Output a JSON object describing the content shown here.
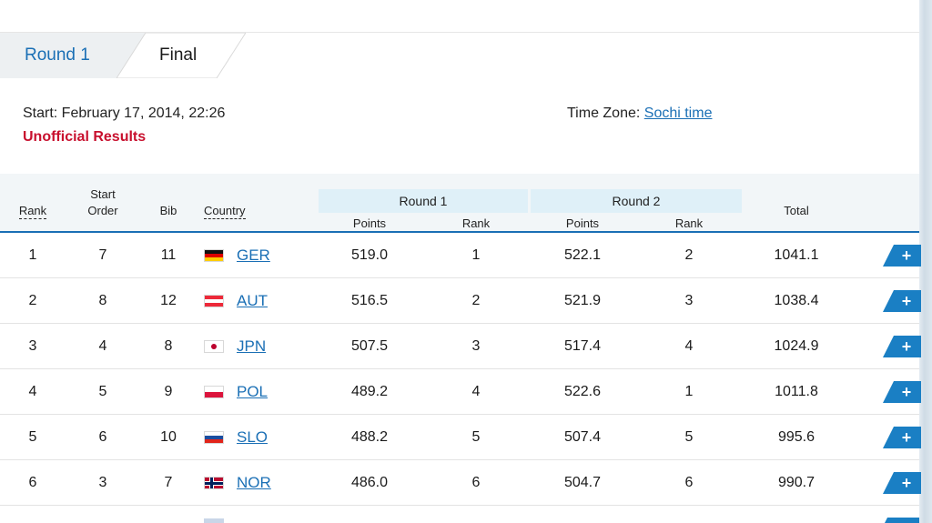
{
  "tabs": [
    {
      "label": "Round 1",
      "active": false
    },
    {
      "label": "Final",
      "active": true
    }
  ],
  "info": {
    "start": "Start: February 17, 2014, 22:26",
    "status": "Unofficial Results",
    "timezone_label": "Time Zone: ",
    "timezone_link": "Sochi time"
  },
  "table": {
    "headers": {
      "rank": "Rank",
      "start_order_1": "Start",
      "start_order_2": "Order",
      "bib": "Bib",
      "country": "Country",
      "round1": "Round 1",
      "round2": "Round 2",
      "points": "Points",
      "rank_sub": "Rank",
      "total": "Total"
    },
    "rows": [
      {
        "rank": "1",
        "order": "7",
        "bib": "11",
        "country": "GER",
        "flag": "germany",
        "r1_points": "519.0",
        "r1_rank": "1",
        "r2_points": "522.1",
        "r2_rank": "2",
        "total": "1041.1"
      },
      {
        "rank": "2",
        "order": "8",
        "bib": "12",
        "country": "AUT",
        "flag": "austria",
        "r1_points": "516.5",
        "r1_rank": "2",
        "r2_points": "521.9",
        "r2_rank": "3",
        "total": "1038.4"
      },
      {
        "rank": "3",
        "order": "4",
        "bib": "8",
        "country": "JPN",
        "flag": "japan",
        "r1_points": "507.5",
        "r1_rank": "3",
        "r2_points": "517.4",
        "r2_rank": "4",
        "total": "1024.9"
      },
      {
        "rank": "4",
        "order": "5",
        "bib": "9",
        "country": "POL",
        "flag": "poland",
        "r1_points": "489.2",
        "r1_rank": "4",
        "r2_points": "522.6",
        "r2_rank": "1",
        "total": "1011.8"
      },
      {
        "rank": "5",
        "order": "6",
        "bib": "10",
        "country": "SLO",
        "flag": "slovenia",
        "r1_points": "488.2",
        "r1_rank": "5",
        "r2_points": "507.4",
        "r2_rank": "5",
        "total": "995.6"
      },
      {
        "rank": "6",
        "order": "3",
        "bib": "7",
        "country": "NOR",
        "flag": "norway",
        "r1_points": "486.0",
        "r1_rank": "6",
        "r2_points": "504.7",
        "r2_rank": "6",
        "total": "990.7"
      }
    ],
    "expand_label": "+"
  },
  "colors": {
    "link": "#1a6fb5",
    "status_red": "#c8102e",
    "header_band": "#dff0f8",
    "expand_button": "#1a7fc4"
  }
}
